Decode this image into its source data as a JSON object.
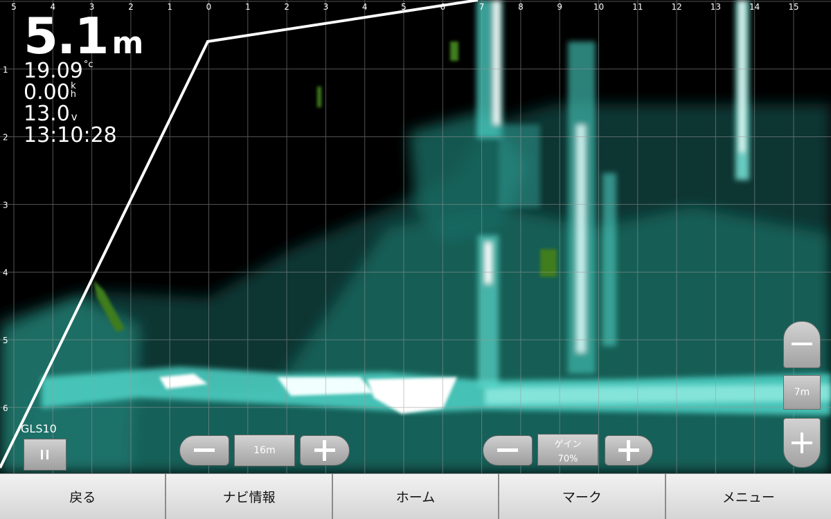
{
  "readout": {
    "depth_value": "5.1",
    "depth_unit": "m",
    "temperature": "19.09",
    "temperature_unit": "°c",
    "speed": "0.00",
    "speed_unit_top": "k",
    "speed_unit_bottom": "h",
    "voltage": "13.0",
    "voltage_unit": "v",
    "time": "13:10:28"
  },
  "scale": {
    "top_labels": [
      "5",
      "4",
      "3",
      "2",
      "1",
      "0",
      "1",
      "2",
      "3",
      "4",
      "5",
      "6",
      "7",
      "8",
      "9",
      "10",
      "11",
      "12",
      "13",
      "14",
      "15"
    ],
    "left_labels": [
      "1",
      "2",
      "3",
      "4",
      "5",
      "6"
    ]
  },
  "controls": {
    "sensor_label": "GLS10",
    "pause_icon": "pause-icon",
    "range_value": "16m",
    "gain_label": "ゲイン",
    "gain_value": "70%",
    "depth_range_value": "7m"
  },
  "bottom_nav": {
    "back": "戻る",
    "nav_info": "ナビ情報",
    "home": "ホーム",
    "mark": "マーク",
    "menu": "メニュー"
  },
  "colors": {
    "sonar_return": "#6df3e6",
    "sonar_strong": "#ffffff",
    "weed": "#3f7d1e"
  }
}
